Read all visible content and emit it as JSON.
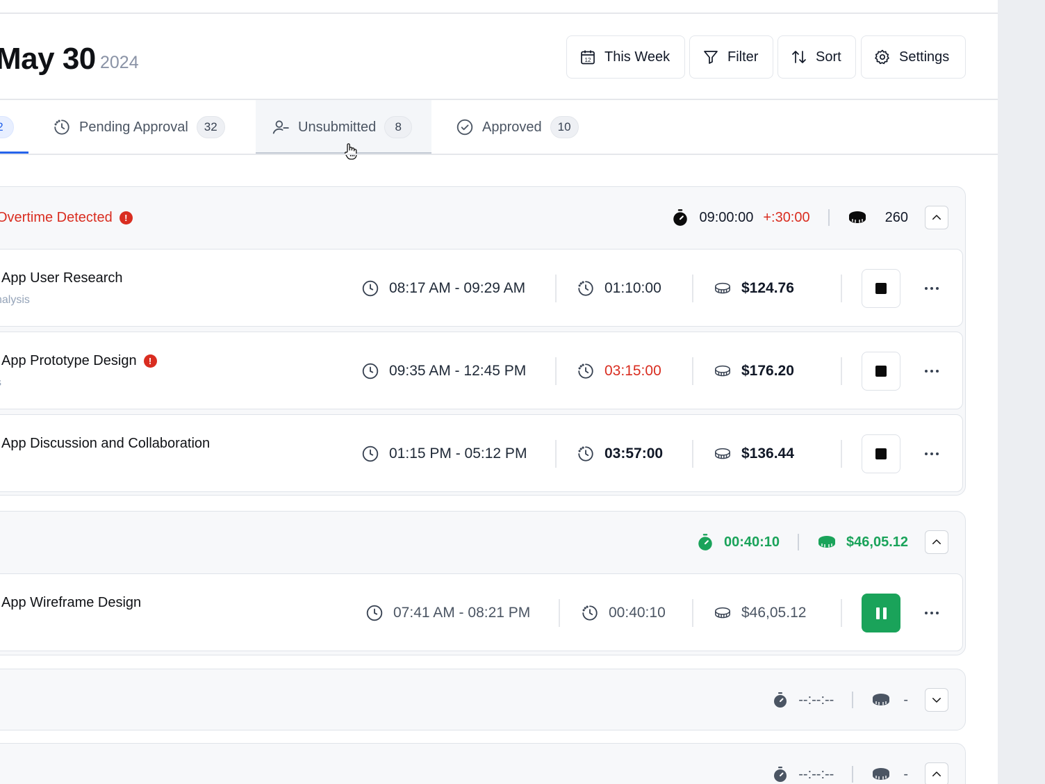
{
  "header": {
    "date": "May 30",
    "year": "2024",
    "buttons": {
      "this_week": "This Week",
      "filter": "Filter",
      "sort": "Sort",
      "settings": "Settings"
    }
  },
  "tabs": [
    {
      "label": "",
      "count": "2",
      "active": true
    },
    {
      "label": "Pending Approval",
      "count": "32",
      "icon": "pending-icon"
    },
    {
      "label": "Unsubmitted",
      "count": "8",
      "icon": "user-minus-icon",
      "hovered": true
    },
    {
      "label": "Approved",
      "count": "10",
      "icon": "check-circle-icon"
    }
  ],
  "groups": [
    {
      "alert": "Overtime Detected",
      "total_time": "09:00:00",
      "overtime": "+:30:00",
      "coins": "260",
      "expanded": true,
      "entries": [
        {
          "title": "App User Research",
          "subtitle": "nalysis",
          "time_range": "08:17 AM - 09:29 AM",
          "duration": "01:10:00",
          "amount": "$124.76",
          "state": "stopped"
        },
        {
          "title": "App Prototype Design",
          "subtitle": "s",
          "time_range": "09:35 AM - 12:45 PM",
          "duration": "03:15:00",
          "amount": "$176.20",
          "state": "stopped",
          "warning": true
        },
        {
          "title": "App Discussion and Collaboration",
          "subtitle": "",
          "time_range": "01:15 PM - 05:12 PM",
          "duration": "03:57:00",
          "amount": "$136.44",
          "state": "stopped"
        }
      ]
    },
    {
      "total_time": "00:40:10",
      "amount": "$46,05.12",
      "expanded": true,
      "entries": [
        {
          "title": "App Wireframe Design",
          "subtitle": "",
          "time_range": "07:41 AM - 08:21 PM",
          "duration": "00:40:10",
          "amount": "$46,05.12",
          "state": "running"
        }
      ]
    },
    {
      "total_time": "--:--:--",
      "amount": "-",
      "expanded": false
    },
    {
      "total_time": "--:--:--",
      "amount": "-",
      "expanded": true
    }
  ],
  "colors": {
    "accent": "#2563eb",
    "alert": "#d92d20",
    "success": "#1aa35a"
  }
}
